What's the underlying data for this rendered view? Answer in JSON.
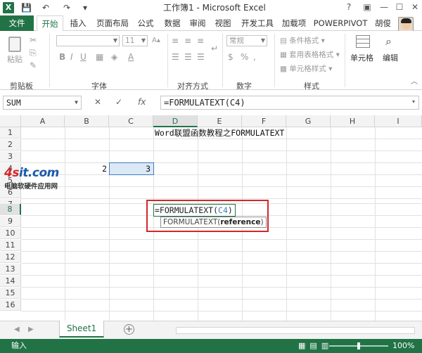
{
  "window": {
    "title": "工作簿1 - Microsoft Excel",
    "app_icon": "X"
  },
  "quick_access": {
    "save_icon": "💾",
    "undo_icon": "↶",
    "redo_icon": "↷",
    "customize_icon": "▾"
  },
  "window_controls": {
    "help": "?",
    "ribbon_options": "▣",
    "minimize": "—",
    "maximize": "☐",
    "close": "✕"
  },
  "tabs": [
    {
      "label": "文件"
    },
    {
      "label": "开始"
    },
    {
      "label": "插入"
    },
    {
      "label": "页面布局"
    },
    {
      "label": "公式"
    },
    {
      "label": "数据"
    },
    {
      "label": "审阅"
    },
    {
      "label": "视图"
    },
    {
      "label": "开发工具"
    },
    {
      "label": "加载项"
    },
    {
      "label": "POWERPIVOT"
    }
  ],
  "user": {
    "name": "胡俊"
  },
  "ribbon": {
    "paste_label": "粘贴",
    "font_size": "11",
    "number_format": "常规",
    "conditional_format": "条件格式",
    "table_format": "套用表格格式",
    "cell_style": "单元格样式",
    "cells_label": "单元格",
    "edit_label": "编辑",
    "groups": {
      "clipboard": "剪贴板",
      "font": "字体",
      "alignment": "对齐方式",
      "number": "数字",
      "styles": "样式"
    }
  },
  "formula_bar": {
    "name_box": "SUM",
    "cancel": "✕",
    "enter": "✓",
    "fx": "fx",
    "formula": "=FORMULATEXT(C4)"
  },
  "columns": [
    "A",
    "B",
    "C",
    "D",
    "E",
    "F",
    "G",
    "H",
    "I"
  ],
  "rows": [
    "1",
    "2",
    "3",
    "4",
    "5",
    "6",
    "7",
    "8",
    "9",
    "10",
    "11",
    "12",
    "13",
    "14",
    "15",
    "16"
  ],
  "cells": {
    "D1": "Word联盟函数教程之FORMULATEXT",
    "B4": "2",
    "C4": "3",
    "D8_prefix": "=FORMULATEXT(",
    "D8_ref": "C4",
    "D8_suffix": ")"
  },
  "tooltip": {
    "func": "FORMULATEXT(",
    "arg": "reference",
    "close": ")"
  },
  "watermark": {
    "logo_a": "4s",
    "logo_b": "it",
    "logo_c": ".com",
    "subtitle": "电脑软硬件应用网"
  },
  "sheets": [
    {
      "name": "Sheet1"
    }
  ],
  "add_sheet": "+",
  "status": {
    "mode": "输入",
    "zoom": "100%",
    "zoom_percent": 100
  }
}
